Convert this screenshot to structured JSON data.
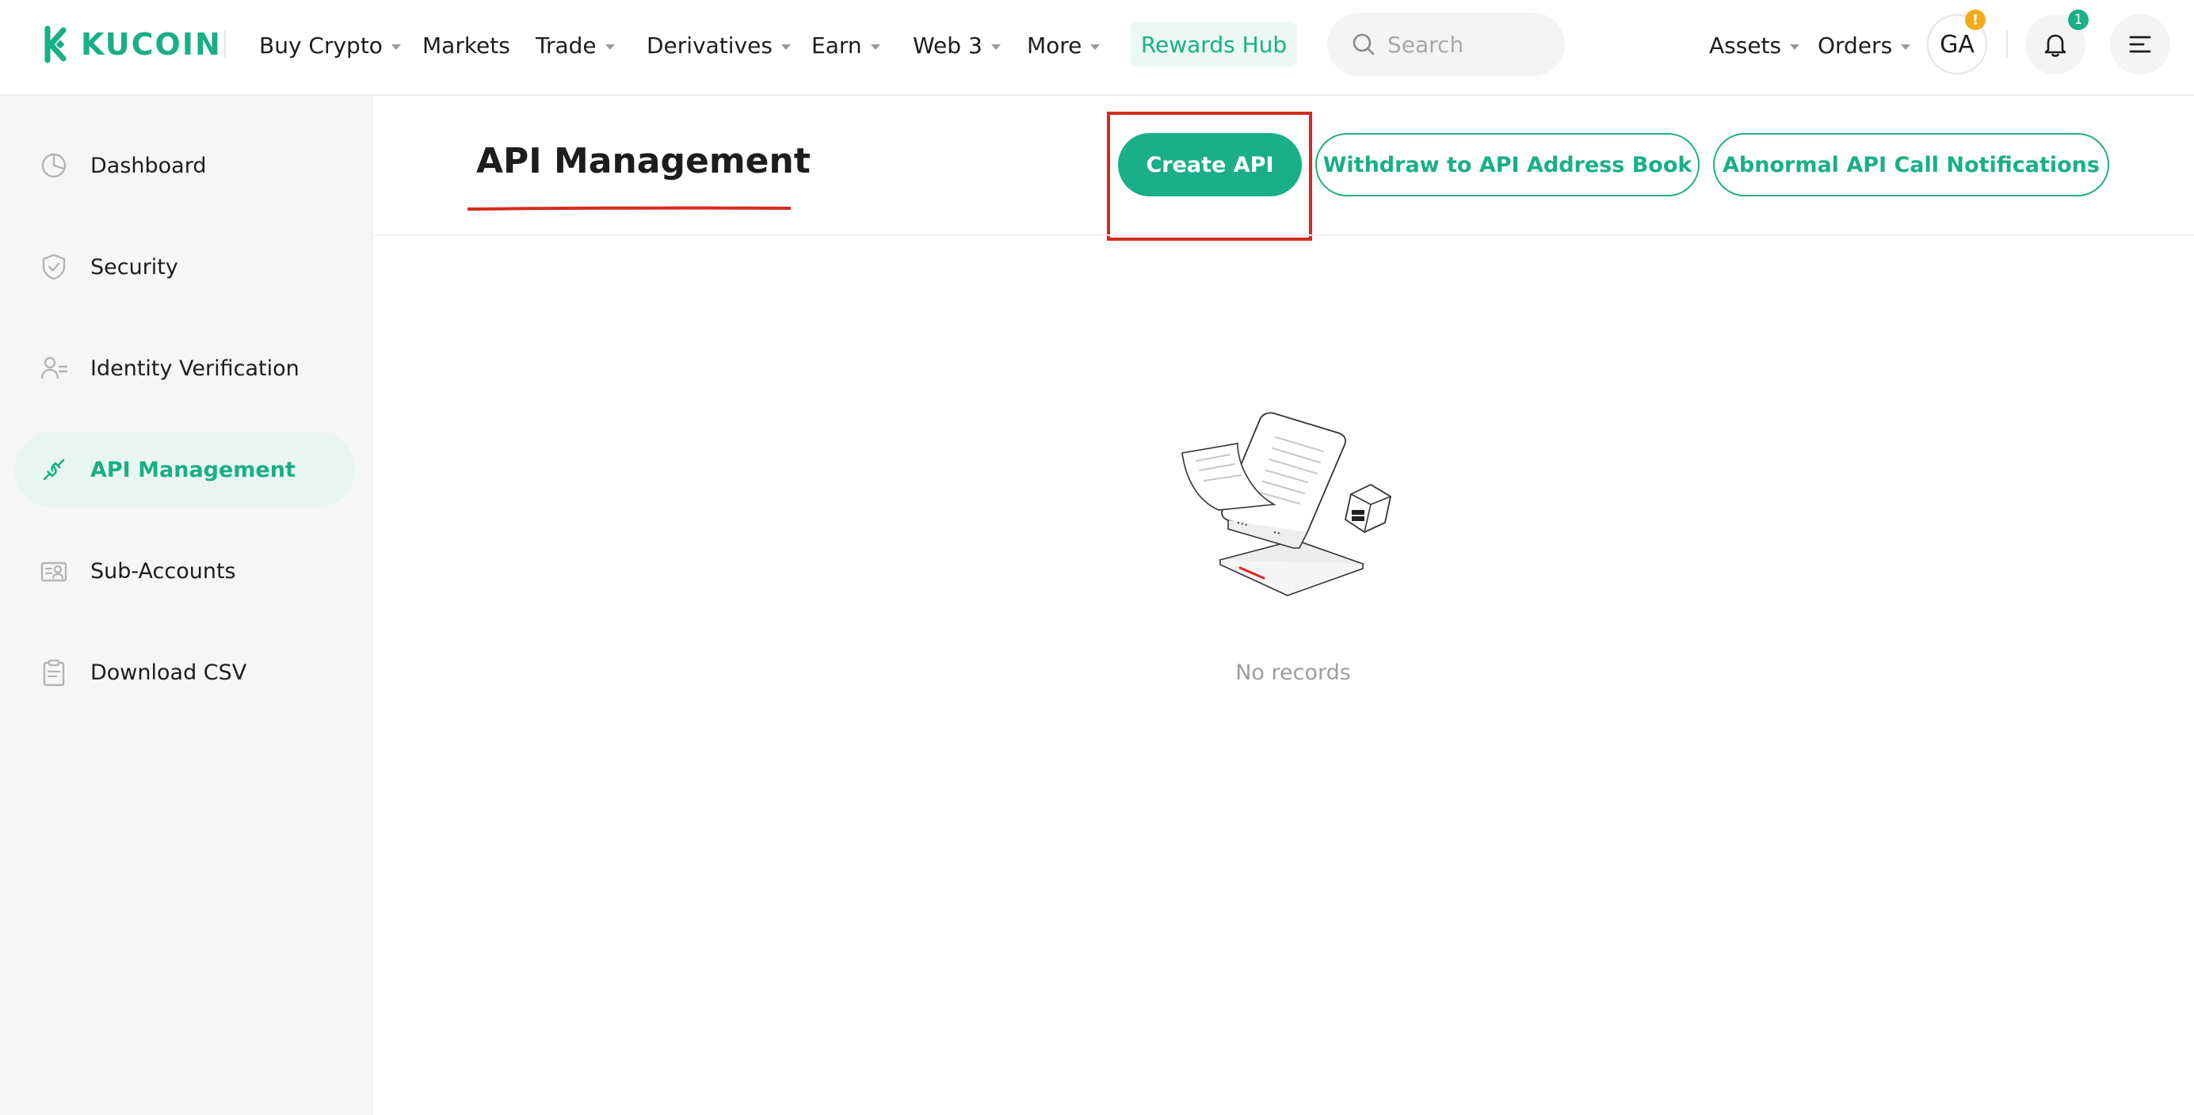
{
  "brand": {
    "name": "KUCOIN",
    "color": "#1aaf86"
  },
  "nav": {
    "buy_crypto": "Buy Crypto",
    "markets": "Markets",
    "trade": "Trade",
    "derivatives": "Derivatives",
    "earn": "Earn",
    "web3": "Web 3",
    "more": "More",
    "rewards_hub": "Rewards Hub"
  },
  "search": {
    "placeholder": "Search"
  },
  "account": {
    "assets": "Assets",
    "orders": "Orders",
    "avatar_initials": "GA",
    "avatar_badge": "!",
    "notification_count": "1"
  },
  "sidebar": {
    "items": [
      {
        "label": "Dashboard",
        "icon": "pie-chart-icon",
        "active": false
      },
      {
        "label": "Security",
        "icon": "shield-icon",
        "active": false
      },
      {
        "label": "Identity Verification",
        "icon": "user-id-icon",
        "active": false
      },
      {
        "label": "API Management",
        "icon": "api-plug-icon",
        "active": true
      },
      {
        "label": "Sub-Accounts",
        "icon": "sub-accounts-icon",
        "active": false
      },
      {
        "label": "Download CSV",
        "icon": "clipboard-icon",
        "active": false
      }
    ]
  },
  "main": {
    "title": "API Management",
    "create_api": "Create API",
    "withdraw_address_book": "Withdraw to API Address Book",
    "abnormal_notifications": "Abnormal API Call Notifications",
    "empty_text": "No records"
  },
  "colors": {
    "accent": "#1aaf86",
    "highlight": "#d62b1d",
    "warning_badge": "#f3ab1b"
  }
}
